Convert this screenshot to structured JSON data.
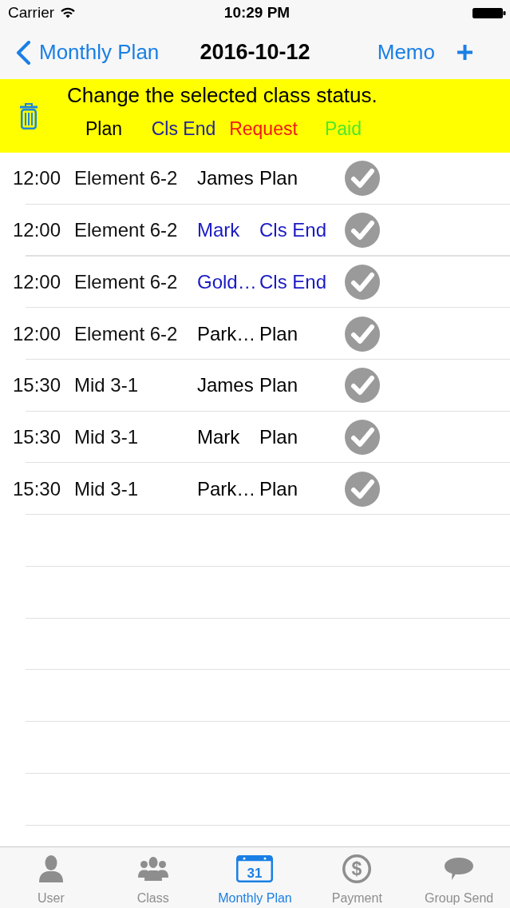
{
  "status_bar": {
    "carrier": "Carrier",
    "time": "10:29 PM"
  },
  "nav_bar": {
    "back": "Monthly Plan",
    "title": "2016-10-12",
    "memo": "Memo"
  },
  "status_banner": {
    "message": "Change the selected class status.",
    "options": [
      {
        "label": "Plan",
        "color": "#000000"
      },
      {
        "label": "Cls End",
        "color": "#24249a"
      },
      {
        "label": "Request",
        "color": "#f01818"
      },
      {
        "label": "Paid",
        "color": "#4fe82a"
      }
    ]
  },
  "classes": [
    {
      "time": "12:00",
      "class": "Element 6-2",
      "student": "James",
      "status": "Plan",
      "color": "#000000",
      "selected": false
    },
    {
      "time": "12:00",
      "class": "Element 6-2",
      "student": "Mark",
      "status": "Cls End",
      "color": "#1a1ac4",
      "selected": false
    },
    {
      "time": "12:00",
      "class": "Element 6-2",
      "student": "Gold…",
      "status": "Cls End",
      "color": "#1a1ac4",
      "selected": false
    },
    {
      "time": "12:00",
      "class": "Element 6-2",
      "student": "Park…",
      "status": "Plan",
      "color": "#000000",
      "selected": false
    },
    {
      "time": "15:30",
      "class": "Mid 3-1",
      "student": "James",
      "status": "Plan",
      "color": "#000000",
      "selected": false
    },
    {
      "time": "15:30",
      "class": "Mid 3-1",
      "student": "Mark",
      "status": "Plan",
      "color": "#000000",
      "selected": false
    },
    {
      "time": "15:30",
      "class": "Mid 3-1",
      "student": "Park…",
      "status": "Plan",
      "color": "#000000",
      "selected": false
    }
  ],
  "tab_bar": [
    {
      "label": "User",
      "kind": "person",
      "selected": false
    },
    {
      "label": "Class",
      "kind": "group",
      "selected": false
    },
    {
      "label": "Monthly Plan",
      "kind": "calendar",
      "icon_text": "31",
      "selected": true
    },
    {
      "label": "Payment",
      "kind": "coin",
      "icon_text": "$",
      "selected": false
    },
    {
      "label": "Group Send",
      "kind": "speech",
      "selected": false
    }
  ]
}
